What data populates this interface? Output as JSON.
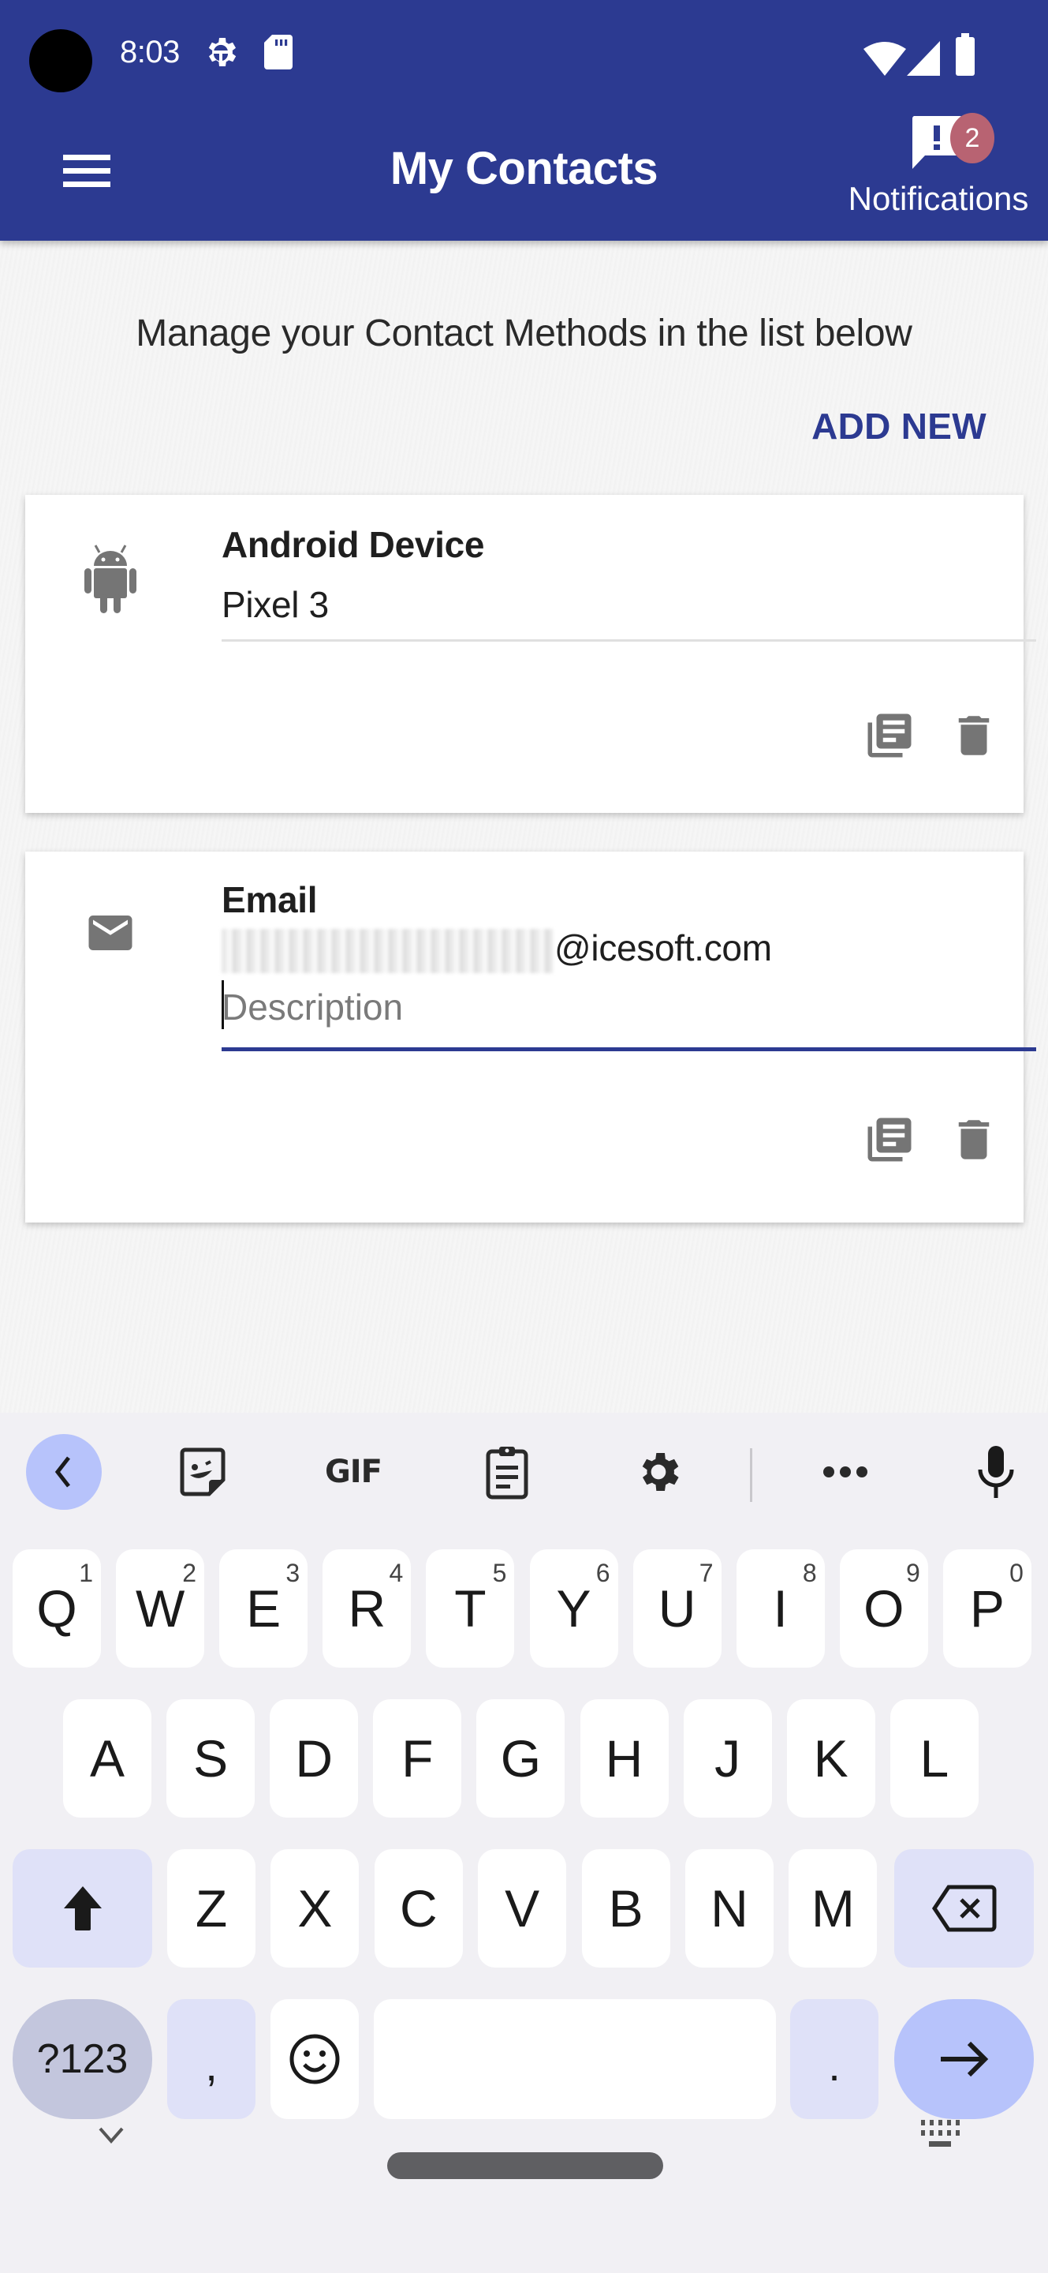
{
  "status_bar": {
    "time": "8:03",
    "left_icons": [
      "settings-gear-icon",
      "sd-card-icon"
    ],
    "right_icons": [
      "wifi-icon",
      "cell-signal-icon",
      "battery-icon"
    ]
  },
  "app_bar": {
    "menu_icon": "hamburger-menu-icon",
    "title": "My Contacts",
    "notifications": {
      "label": "Notifications",
      "icon": "feedback-alert-icon",
      "badge_count": "2"
    }
  },
  "colors": {
    "primary": "#2c3a91",
    "badge": "#b86372",
    "icon_gray": "#757575",
    "keyboard_accent": "#b7c3fb"
  },
  "main": {
    "intro": "Manage your Contact Methods in the list below",
    "add_new_label": "ADD NEW",
    "contacts": [
      {
        "icon": "android-icon",
        "type": "Android Device",
        "value": "Pixel 3",
        "actions": [
          "library-books-icon",
          "delete-icon"
        ]
      },
      {
        "icon": "email-icon",
        "type": "Email",
        "value_redacted": true,
        "value_suffix": "@icesoft.com",
        "description_value": "",
        "description_placeholder": "Description",
        "actions": [
          "library-books-icon",
          "delete-icon"
        ]
      }
    ]
  },
  "keyboard": {
    "toolbar": [
      "back-icon",
      "sticker-icon",
      "GIF",
      "clipboard-icon",
      "settings-icon",
      "more-icon",
      "microphone-icon"
    ],
    "gif_label": "GIF",
    "more_label": "•••",
    "row1": [
      {
        "key": "Q",
        "hint": "1"
      },
      {
        "key": "W",
        "hint": "2"
      },
      {
        "key": "E",
        "hint": "3"
      },
      {
        "key": "R",
        "hint": "4"
      },
      {
        "key": "T",
        "hint": "5"
      },
      {
        "key": "Y",
        "hint": "6"
      },
      {
        "key": "U",
        "hint": "7"
      },
      {
        "key": "I",
        "hint": "8"
      },
      {
        "key": "O",
        "hint": "9"
      },
      {
        "key": "P",
        "hint": "0"
      }
    ],
    "row2": [
      "A",
      "S",
      "D",
      "F",
      "G",
      "H",
      "J",
      "K",
      "L"
    ],
    "row3": [
      "Z",
      "X",
      "C",
      "V",
      "B",
      "N",
      "M"
    ],
    "symbols_label": "?123",
    "comma_label": ",",
    "period_label": ".",
    "bottom_icons": [
      "collapse-keyboard-icon",
      "switch-keyboard-icon"
    ]
  }
}
